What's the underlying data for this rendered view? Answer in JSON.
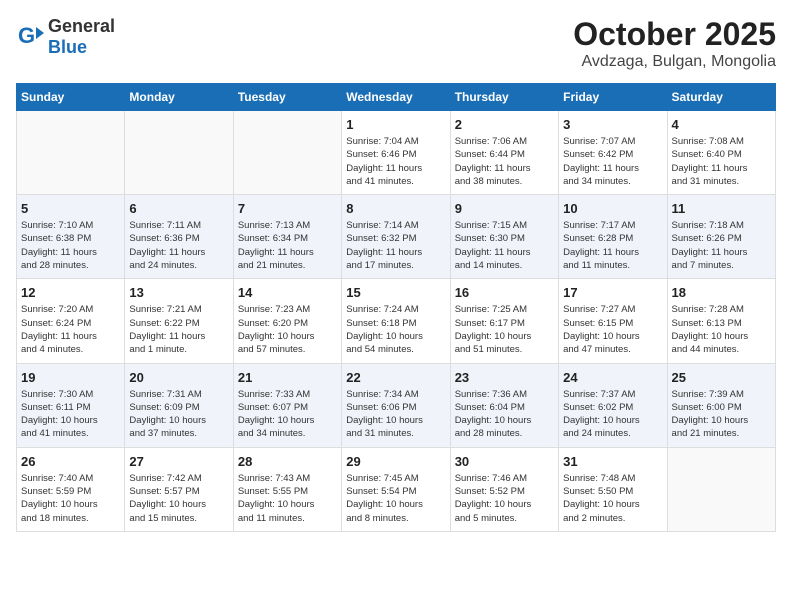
{
  "header": {
    "logo_general": "General",
    "logo_blue": "Blue",
    "month": "October 2025",
    "location": "Avdzaga, Bulgan, Mongolia"
  },
  "weekdays": [
    "Sunday",
    "Monday",
    "Tuesday",
    "Wednesday",
    "Thursday",
    "Friday",
    "Saturday"
  ],
  "weeks": [
    [
      {
        "day": "",
        "info": ""
      },
      {
        "day": "",
        "info": ""
      },
      {
        "day": "",
        "info": ""
      },
      {
        "day": "1",
        "info": "Sunrise: 7:04 AM\nSunset: 6:46 PM\nDaylight: 11 hours\nand 41 minutes."
      },
      {
        "day": "2",
        "info": "Sunrise: 7:06 AM\nSunset: 6:44 PM\nDaylight: 11 hours\nand 38 minutes."
      },
      {
        "day": "3",
        "info": "Sunrise: 7:07 AM\nSunset: 6:42 PM\nDaylight: 11 hours\nand 34 minutes."
      },
      {
        "day": "4",
        "info": "Sunrise: 7:08 AM\nSunset: 6:40 PM\nDaylight: 11 hours\nand 31 minutes."
      }
    ],
    [
      {
        "day": "5",
        "info": "Sunrise: 7:10 AM\nSunset: 6:38 PM\nDaylight: 11 hours\nand 28 minutes."
      },
      {
        "day": "6",
        "info": "Sunrise: 7:11 AM\nSunset: 6:36 PM\nDaylight: 11 hours\nand 24 minutes."
      },
      {
        "day": "7",
        "info": "Sunrise: 7:13 AM\nSunset: 6:34 PM\nDaylight: 11 hours\nand 21 minutes."
      },
      {
        "day": "8",
        "info": "Sunrise: 7:14 AM\nSunset: 6:32 PM\nDaylight: 11 hours\nand 17 minutes."
      },
      {
        "day": "9",
        "info": "Sunrise: 7:15 AM\nSunset: 6:30 PM\nDaylight: 11 hours\nand 14 minutes."
      },
      {
        "day": "10",
        "info": "Sunrise: 7:17 AM\nSunset: 6:28 PM\nDaylight: 11 hours\nand 11 minutes."
      },
      {
        "day": "11",
        "info": "Sunrise: 7:18 AM\nSunset: 6:26 PM\nDaylight: 11 hours\nand 7 minutes."
      }
    ],
    [
      {
        "day": "12",
        "info": "Sunrise: 7:20 AM\nSunset: 6:24 PM\nDaylight: 11 hours\nand 4 minutes."
      },
      {
        "day": "13",
        "info": "Sunrise: 7:21 AM\nSunset: 6:22 PM\nDaylight: 11 hours\nand 1 minute."
      },
      {
        "day": "14",
        "info": "Sunrise: 7:23 AM\nSunset: 6:20 PM\nDaylight: 10 hours\nand 57 minutes."
      },
      {
        "day": "15",
        "info": "Sunrise: 7:24 AM\nSunset: 6:18 PM\nDaylight: 10 hours\nand 54 minutes."
      },
      {
        "day": "16",
        "info": "Sunrise: 7:25 AM\nSunset: 6:17 PM\nDaylight: 10 hours\nand 51 minutes."
      },
      {
        "day": "17",
        "info": "Sunrise: 7:27 AM\nSunset: 6:15 PM\nDaylight: 10 hours\nand 47 minutes."
      },
      {
        "day": "18",
        "info": "Sunrise: 7:28 AM\nSunset: 6:13 PM\nDaylight: 10 hours\nand 44 minutes."
      }
    ],
    [
      {
        "day": "19",
        "info": "Sunrise: 7:30 AM\nSunset: 6:11 PM\nDaylight: 10 hours\nand 41 minutes."
      },
      {
        "day": "20",
        "info": "Sunrise: 7:31 AM\nSunset: 6:09 PM\nDaylight: 10 hours\nand 37 minutes."
      },
      {
        "day": "21",
        "info": "Sunrise: 7:33 AM\nSunset: 6:07 PM\nDaylight: 10 hours\nand 34 minutes."
      },
      {
        "day": "22",
        "info": "Sunrise: 7:34 AM\nSunset: 6:06 PM\nDaylight: 10 hours\nand 31 minutes."
      },
      {
        "day": "23",
        "info": "Sunrise: 7:36 AM\nSunset: 6:04 PM\nDaylight: 10 hours\nand 28 minutes."
      },
      {
        "day": "24",
        "info": "Sunrise: 7:37 AM\nSunset: 6:02 PM\nDaylight: 10 hours\nand 24 minutes."
      },
      {
        "day": "25",
        "info": "Sunrise: 7:39 AM\nSunset: 6:00 PM\nDaylight: 10 hours\nand 21 minutes."
      }
    ],
    [
      {
        "day": "26",
        "info": "Sunrise: 7:40 AM\nSunset: 5:59 PM\nDaylight: 10 hours\nand 18 minutes."
      },
      {
        "day": "27",
        "info": "Sunrise: 7:42 AM\nSunset: 5:57 PM\nDaylight: 10 hours\nand 15 minutes."
      },
      {
        "day": "28",
        "info": "Sunrise: 7:43 AM\nSunset: 5:55 PM\nDaylight: 10 hours\nand 11 minutes."
      },
      {
        "day": "29",
        "info": "Sunrise: 7:45 AM\nSunset: 5:54 PM\nDaylight: 10 hours\nand 8 minutes."
      },
      {
        "day": "30",
        "info": "Sunrise: 7:46 AM\nSunset: 5:52 PM\nDaylight: 10 hours\nand 5 minutes."
      },
      {
        "day": "31",
        "info": "Sunrise: 7:48 AM\nSunset: 5:50 PM\nDaylight: 10 hours\nand 2 minutes."
      },
      {
        "day": "",
        "info": ""
      }
    ]
  ]
}
